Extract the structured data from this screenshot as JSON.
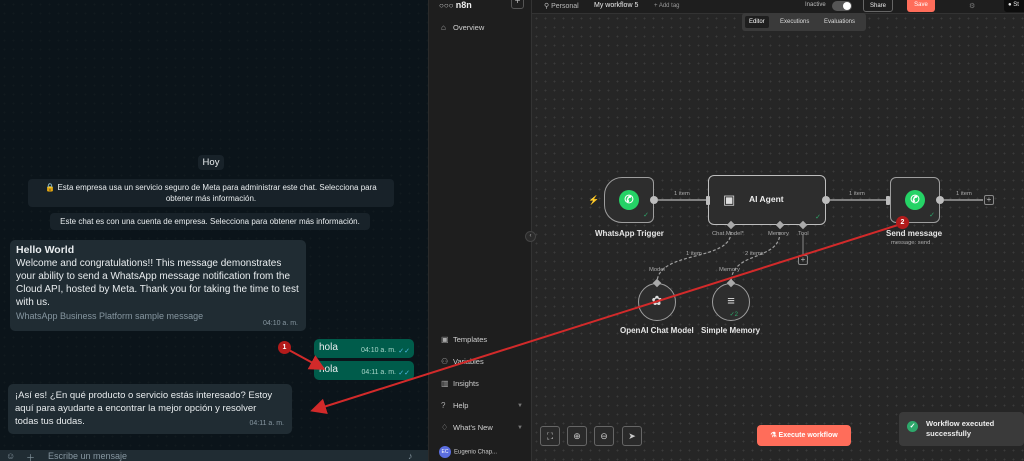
{
  "whatsapp": {
    "day_label": "Hoy",
    "notice_security": "Esta empresa usa un servicio seguro de Meta para administrar este chat. Selecciona para obtener más información.",
    "notice_business": "Este chat es con una cuenta de empresa. Selecciona para obtener más información.",
    "template_message": {
      "title": "Hello World",
      "body": "Welcome and congratulations!! This message demonstrates your ability to send a WhatsApp message notification from the Cloud API, hosted by Meta. Thank you for taking the time to test with us.",
      "footer": "WhatsApp Business Platform sample message",
      "time": "04:10 a. m."
    },
    "outgoing": [
      {
        "text": "hola",
        "time": "04:10 a. m.",
        "ticks": "✓✓"
      },
      {
        "text": "hola",
        "time": "04:11 a. m.",
        "ticks": "✓✓"
      }
    ],
    "reply": {
      "text": "¡Así es! ¿En qué producto o servicio estás interesado? Estoy aquí para ayudarte a encontrar la mejor opción y resolver todas tus dudas.",
      "time": "04:11 a. m."
    },
    "input_placeholder": "Escribe un mensaje"
  },
  "n8n": {
    "brand": "n8n",
    "sidebar": {
      "items": [
        {
          "label": "Overview",
          "icon": "home-icon"
        },
        {
          "label": "Templates",
          "icon": "box-icon"
        },
        {
          "label": "Variables",
          "icon": "variables-icon"
        },
        {
          "label": "Insights",
          "icon": "chart-icon"
        },
        {
          "label": "Help",
          "icon": "help-icon"
        },
        {
          "label": "What's New",
          "icon": "bell-icon"
        }
      ],
      "user_initials": "EC",
      "user_name": "Eugenio Chap..."
    },
    "header": {
      "project": "Personal",
      "workflow_name": "My workflow 5",
      "add_tag": "+ Add tag",
      "status": "Inactive",
      "share_label": "Share",
      "save_label": "Save",
      "github_label": "St"
    },
    "tabs": [
      "Editor",
      "Executions",
      "Evaluations"
    ],
    "nodes": {
      "trigger": "WhatsApp Trigger",
      "agent": "AI Agent",
      "send": "Send message",
      "send_subtitle": "message: send",
      "openai": "OpenAI Chat Model",
      "memory": "Simple Memory",
      "memory_count": "2"
    },
    "ports": {
      "chat_model": "Chat Model*",
      "memory": "Memory",
      "tool": "Tool",
      "model": "Model",
      "memory_in": "Memory"
    },
    "edge_labels": {
      "trigger_agent": "1 item",
      "agent_send": "1 item",
      "send_out": "1 item",
      "model_link": "1 item",
      "memory_link": "2 items"
    },
    "execute_label": "Execute workflow",
    "toast": "Workflow executed successfully",
    "colors": {
      "accent": "#ff6d5a",
      "whatsapp": "#25d366",
      "success": "#2ea86b",
      "annotation": "#d22a2a"
    }
  },
  "annotations": [
    "1",
    "2"
  ]
}
